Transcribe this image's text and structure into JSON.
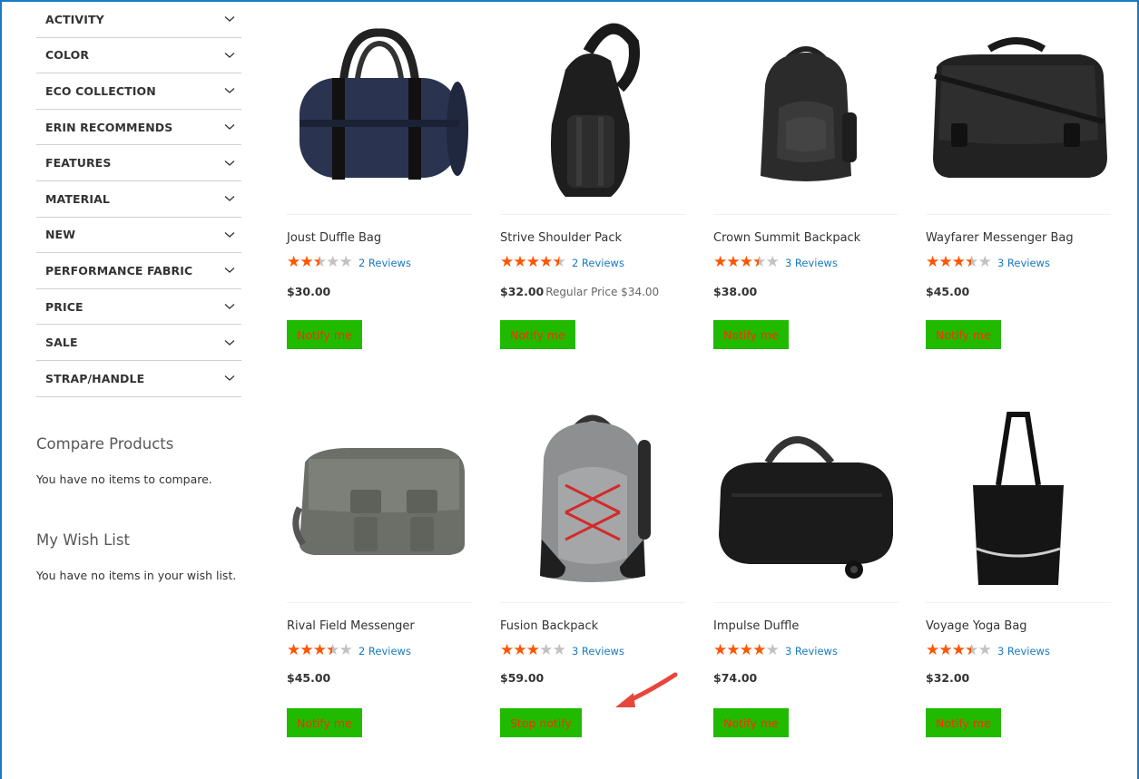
{
  "filters": [
    {
      "label": "ACTIVITY"
    },
    {
      "label": "COLOR"
    },
    {
      "label": "ECO COLLECTION"
    },
    {
      "label": "ERIN RECOMMENDS"
    },
    {
      "label": "FEATURES"
    },
    {
      "label": "MATERIAL"
    },
    {
      "label": "NEW"
    },
    {
      "label": "PERFORMANCE FABRIC"
    },
    {
      "label": "PRICE"
    },
    {
      "label": "SALE"
    },
    {
      "label": "STRAP/HANDLE"
    }
  ],
  "compare": {
    "title": "Compare Products",
    "empty_text": "You have no items to compare."
  },
  "wishlist": {
    "title": "My Wish List",
    "empty_text": "You have no items in your wish list."
  },
  "products": [
    {
      "name": "Joust Duffle Bag",
      "rating": 2.5,
      "reviews": "2 Reviews",
      "price": "$30.00",
      "regular_price": "",
      "button": "Notify me"
    },
    {
      "name": "Strive Shoulder Pack",
      "rating": 4.5,
      "reviews": "2 Reviews",
      "price": "$32.00",
      "regular_price": "Regular Price $34.00",
      "button": "Notify me"
    },
    {
      "name": "Crown Summit Backpack",
      "rating": 3.5,
      "reviews": "3 Reviews",
      "price": "$38.00",
      "regular_price": "",
      "button": "Notify me"
    },
    {
      "name": "Wayfarer Messenger Bag",
      "rating": 3.5,
      "reviews": "3 Reviews",
      "price": "$45.00",
      "regular_price": "",
      "button": "Notify me"
    },
    {
      "name": "Rival Field Messenger",
      "rating": 3.5,
      "reviews": "2 Reviews",
      "price": "$45.00",
      "regular_price": "",
      "button": "Notify me"
    },
    {
      "name": "Fusion Backpack",
      "rating": 3,
      "reviews": "3 Reviews",
      "price": "$59.00",
      "regular_price": "",
      "button": "Stop notify"
    },
    {
      "name": "Impulse Duffle",
      "rating": 4,
      "reviews": "3 Reviews",
      "price": "$74.00",
      "regular_price": "",
      "button": "Notify me"
    },
    {
      "name": "Voyage Yoga Bag",
      "rating": 3.5,
      "reviews": "3 Reviews",
      "price": "$32.00",
      "regular_price": "",
      "button": "Notify me"
    }
  ],
  "colors": {
    "star": "#ff5501",
    "star_empty": "#c2c2c2",
    "link": "#1979c3",
    "button_bg": "#20ba00",
    "button_text": "#ff2d00",
    "arrow": "#e8463c"
  }
}
